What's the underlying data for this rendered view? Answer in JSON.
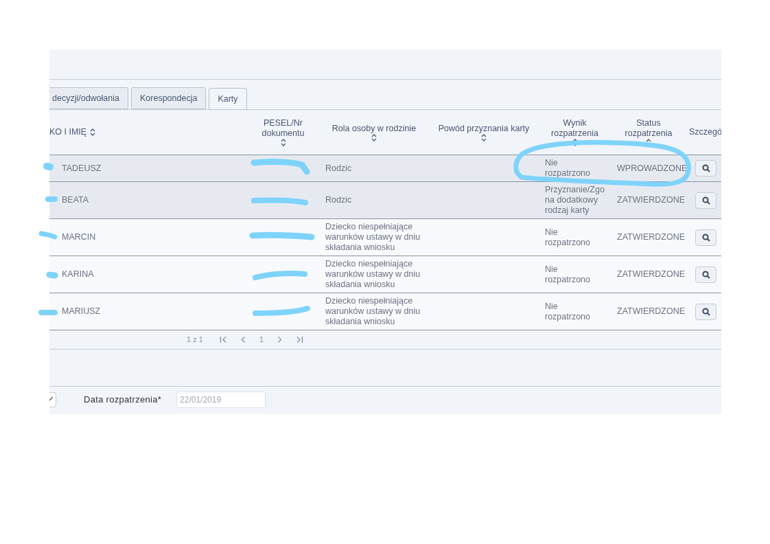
{
  "tabs": [
    {
      "label": "decyzji/odwołania",
      "selected": false
    },
    {
      "label": "Korespondecja",
      "selected": false
    },
    {
      "label": "Karty",
      "selected": true
    }
  ],
  "table": {
    "columns": [
      "KO I IMIĘ",
      "PESEL/Nr dokumentu",
      "Rola osoby w rodzinie",
      "Powód przyznania karty",
      "Wynik rozpatrzenia",
      "Status rozpatrzenia",
      "Szczegó"
    ],
    "rows": [
      {
        "name": "TADEUSZ",
        "role": "Rodzic",
        "result": "Nie rozpatrzono",
        "status": "WPROWADZONE",
        "selected": true
      },
      {
        "name": "BEATA",
        "role": "Rodzic",
        "result": "Przyznanie/Zgo na dodatkowy rodzaj karty",
        "status": "ZATWIERDZONE",
        "selected": true
      },
      {
        "name": "MARCIN",
        "role": "Dziecko niespełniające warunków ustawy w dniu składania wniosku",
        "result": "Nie rozpatrzono",
        "status": "ZATWIERDZONE",
        "selected": false
      },
      {
        "name": "KARINA",
        "role": "Dziecko niespełniające warunków ustawy w dniu składania wniosku",
        "result": "Nie rozpatrzono",
        "status": "ZATWIERDZONE",
        "selected": false
      },
      {
        "name": "MARIUSZ",
        "role": "Dziecko niespełniające warunków ustawy w dniu składania wniosku",
        "result": "Nie rozpatrzono",
        "status": "ZATWIERDZONE",
        "selected": false
      }
    ]
  },
  "pagination": {
    "summary": "1 z 1",
    "page": "1"
  },
  "form": {
    "checkbox": {
      "checked": true
    },
    "date_label": "Data rozpatrzenia*",
    "date_value": "22/01/2019",
    "date_disabled": true
  }
}
